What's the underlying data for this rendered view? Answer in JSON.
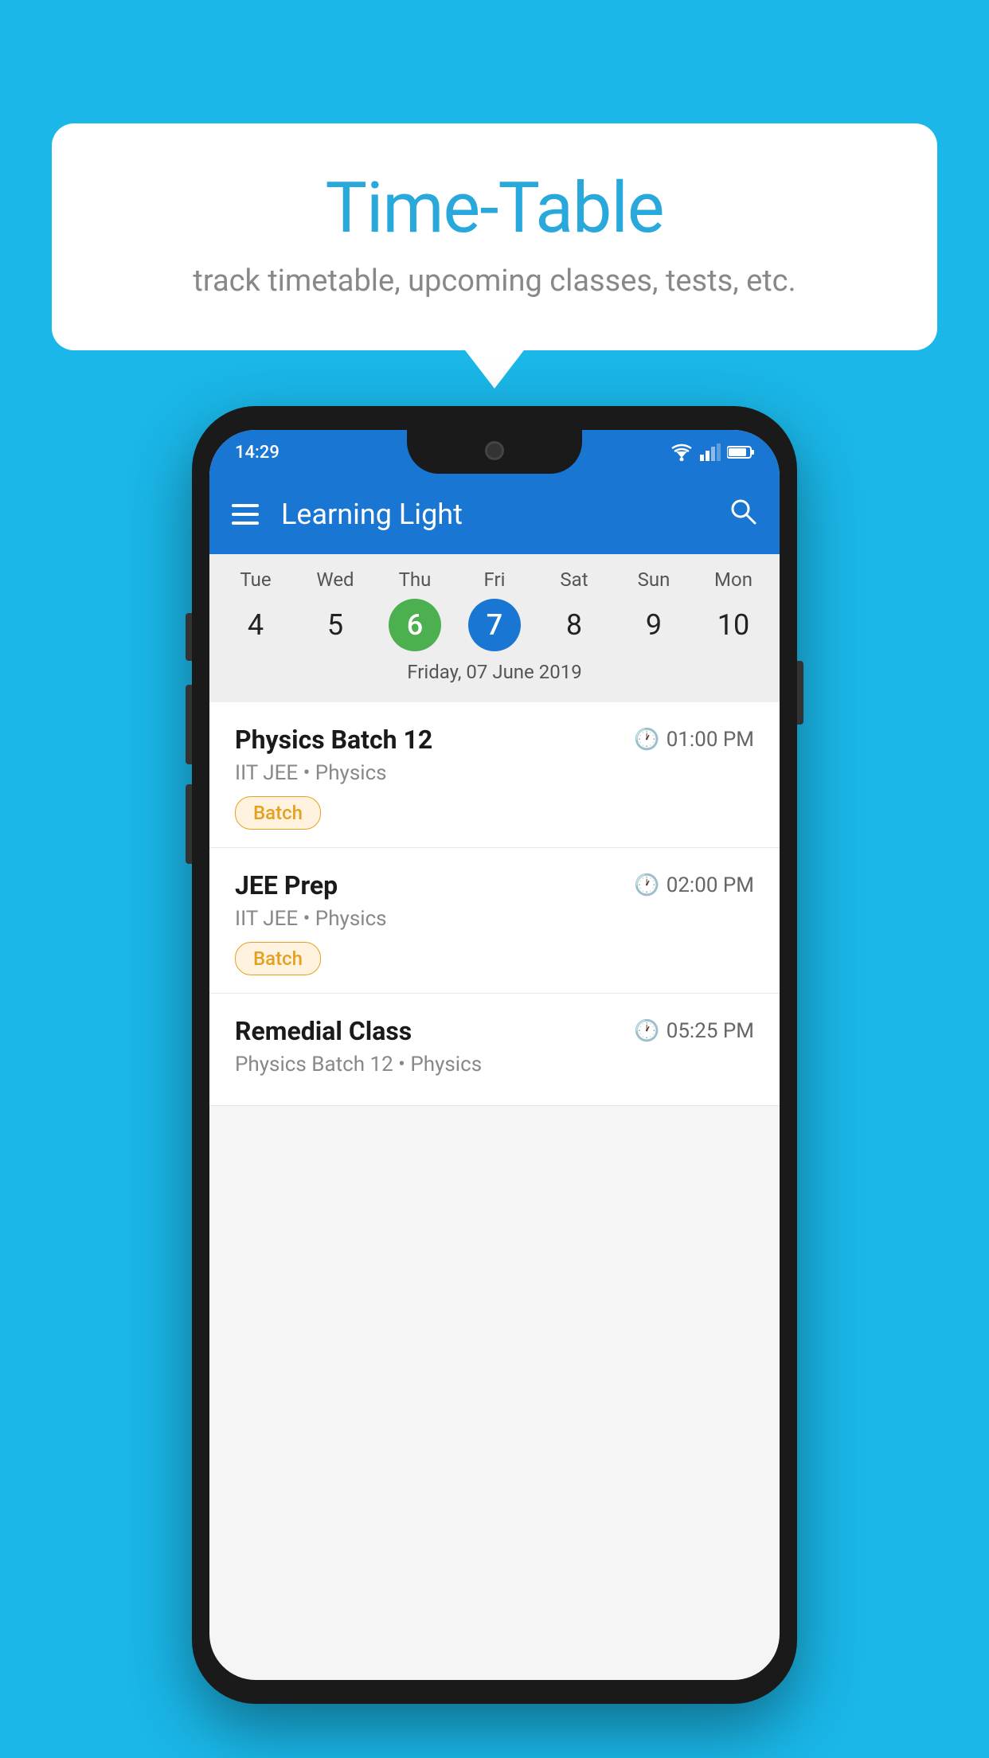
{
  "page": {
    "background_color": "#1ab7e8"
  },
  "bubble": {
    "title": "Time-Table",
    "subtitle": "track timetable, upcoming classes, tests, etc."
  },
  "status_bar": {
    "time": "14:29"
  },
  "app_bar": {
    "title": "Learning Light",
    "search_label": "search"
  },
  "calendar": {
    "days": [
      {
        "name": "Tue",
        "num": "4",
        "state": "normal"
      },
      {
        "name": "Wed",
        "num": "5",
        "state": "normal"
      },
      {
        "name": "Thu",
        "num": "6",
        "state": "today"
      },
      {
        "name": "Fri",
        "num": "7",
        "state": "selected"
      },
      {
        "name": "Sat",
        "num": "8",
        "state": "normal"
      },
      {
        "name": "Sun",
        "num": "9",
        "state": "normal"
      },
      {
        "name": "Mon",
        "num": "10",
        "state": "normal"
      }
    ],
    "selected_label": "Friday, 07 June 2019"
  },
  "classes": [
    {
      "name": "Physics Batch 12",
      "time": "01:00 PM",
      "subject_line": "IIT JEE • Physics",
      "tag": "Batch"
    },
    {
      "name": "JEE Prep",
      "time": "02:00 PM",
      "subject_line": "IIT JEE • Physics",
      "tag": "Batch"
    },
    {
      "name": "Remedial Class",
      "time": "05:25 PM",
      "subject_line": "Physics Batch 12 • Physics",
      "tag": ""
    }
  ],
  "icons": {
    "hamburger": "≡",
    "search": "🔍",
    "clock": "🕐"
  }
}
